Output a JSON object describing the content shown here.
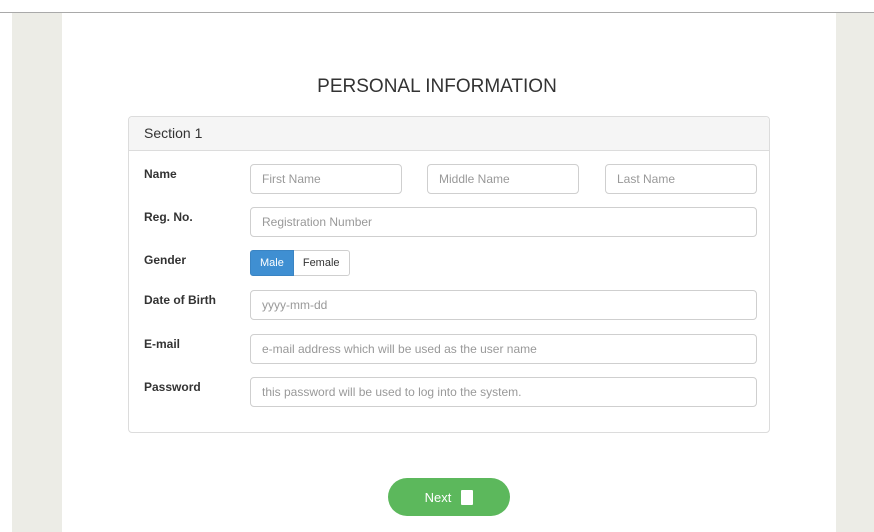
{
  "page": {
    "title": "PERSONAL INFORMATION"
  },
  "section": {
    "header": "Section 1"
  },
  "fields": {
    "name": {
      "label": "Name",
      "first_placeholder": "First Name",
      "middle_placeholder": "Middle Name",
      "last_placeholder": "Last Name"
    },
    "reg": {
      "label": "Reg. No.",
      "placeholder": "Registration Number"
    },
    "gender": {
      "label": "Gender",
      "options": [
        "Male",
        "Female"
      ],
      "selected": "Male"
    },
    "dob": {
      "label": "Date of Birth",
      "placeholder": "yyyy-mm-dd"
    },
    "email": {
      "label": "E-mail",
      "placeholder": "e-mail address which will be used as the user name"
    },
    "password": {
      "label": "Password",
      "placeholder": "this password will be used to log into the system."
    }
  },
  "actions": {
    "next_label": "Next",
    "next_icon": "document-icon"
  },
  "colors": {
    "primary": "#3f8fd2",
    "success": "#5cb85c",
    "sidebar": "#ecece6"
  }
}
